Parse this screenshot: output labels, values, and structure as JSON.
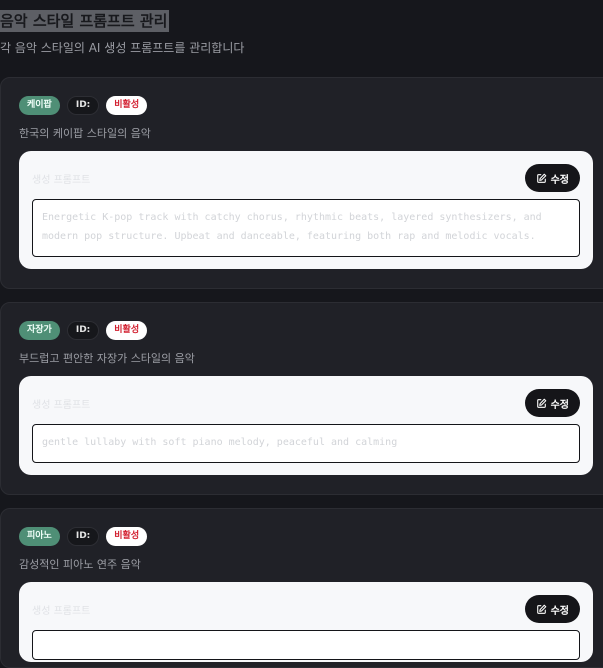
{
  "header": {
    "title": "음악 스타일 프롬프트 관리",
    "subtitle": "각 음악 스타일의 AI 생성 프롬프트를 관리합니다"
  },
  "cards": [
    {
      "style": "케이팝",
      "id_label": "ID:",
      "status": "비활성",
      "description": "한국의 케이팝 스타일의 음악",
      "prompt_label": "생성 프롬프트",
      "edit_label": "수정",
      "prompt": "Energetic K-pop track with catchy chorus, rhythmic beats, layered synthesizers, and modern pop structure. Upbeat and danceable, featuring both rap and melodic vocals."
    },
    {
      "style": "자장가",
      "id_label": "ID:",
      "status": "비활성",
      "description": "부드럽고 편안한 자장가 스타일의 음악",
      "prompt_label": "생성 프롬프트",
      "edit_label": "수정",
      "prompt": "gentle lullaby with soft piano melody, peaceful and calming"
    },
    {
      "style": "피아노",
      "id_label": "ID:",
      "status": "비활성",
      "description": "감성적인 피아노 연주 음악",
      "prompt_label": "생성 프롬프트",
      "edit_label": "수정",
      "prompt": ""
    }
  ],
  "colors": {
    "background": "#16171c",
    "card": "#202127",
    "style_badge": "#4f8f76",
    "status_text": "#d21f2f"
  }
}
